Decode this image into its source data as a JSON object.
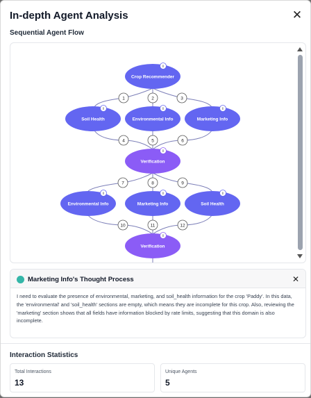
{
  "modal": {
    "title": "In-depth Agent Analysis",
    "close_icon": "close-icon"
  },
  "flow": {
    "section_label": "Sequential Agent Flow",
    "nodes": [
      {
        "label": "Crop Recommender"
      },
      {
        "label": "Soil Health"
      },
      {
        "label": "Environmental Info"
      },
      {
        "label": "Marketing Info"
      },
      {
        "label": "Verification"
      },
      {
        "label": "Environmental Info"
      },
      {
        "label": "Marketing Info"
      },
      {
        "label": "Soil Health"
      },
      {
        "label": "Verification"
      }
    ],
    "edges": [
      {
        "step": "1"
      },
      {
        "step": "2"
      },
      {
        "step": "3"
      },
      {
        "step": "4"
      },
      {
        "step": "5"
      },
      {
        "step": "6"
      },
      {
        "step": "7"
      },
      {
        "step": "8"
      },
      {
        "step": "9"
      },
      {
        "step": "10"
      },
      {
        "step": "11"
      },
      {
        "step": "12"
      }
    ],
    "info_badge": "i",
    "colors": {
      "node": "#6366f1",
      "verification_node": "#8b5cf6",
      "edge": "#7c7fb8"
    }
  },
  "thought": {
    "title": "Marketing Info's Thought Process",
    "accent_color": "#34b6a8",
    "body": "I need to evaluate the presence of environmental, marketing, and soil_health information for the crop 'Paddy'. In this data, the 'environmental' and 'soil_health' sections are empty, which means they are incomplete for this crop. Also, reviewing the 'marketing' section shows that all fields have information blocked by rate limits, suggesting that this domain is also incomplete."
  },
  "stats": {
    "label": "Interaction Statistics",
    "total_label": "Total Interactions",
    "total_value": "13",
    "unique_label": "Unique Agents",
    "unique_value": "5"
  }
}
